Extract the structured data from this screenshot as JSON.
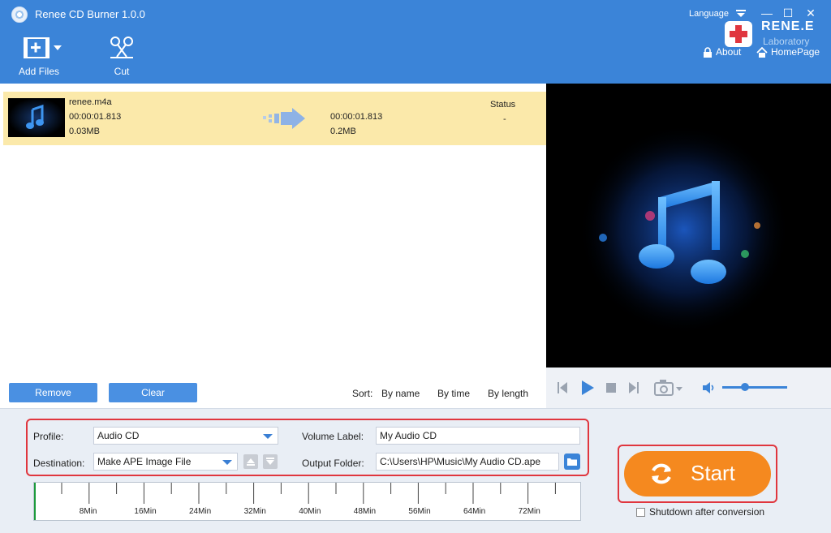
{
  "app": {
    "title": "Renee CD Burner 1.0.0",
    "language_label": "Language"
  },
  "window": {
    "minimize": "—",
    "maximize": "☐",
    "close": "✕"
  },
  "toolbar": {
    "add_files_label": "Add Files",
    "cut_label": "Cut"
  },
  "brand": {
    "name": "RENE.E",
    "sub": "Laboratory",
    "about_label": "About",
    "homepage_label": "HomePage"
  },
  "file": {
    "name": "renee.m4a",
    "src_duration": "00:00:01.813",
    "src_size": "0.03MB",
    "out_duration": "00:00:01.813",
    "out_size": "0.2MB",
    "status_header": "Status",
    "status_value": "-"
  },
  "list_actions": {
    "remove_label": "Remove",
    "clear_label": "Clear"
  },
  "sort": {
    "label": "Sort:",
    "by_name": "By name",
    "by_time": "By time",
    "by_length": "By length"
  },
  "player": {
    "volume_level": 0.35
  },
  "settings": {
    "profile_label": "Profile:",
    "profile_value": "Audio CD",
    "destination_label": "Destination:",
    "destination_value": "Make APE Image File",
    "volume_label_label": "Volume Label:",
    "volume_label_value": "My Audio CD",
    "output_folder_label": "Output Folder:",
    "output_folder_value": "C:\\Users\\HP\\Music\\My Audio CD.ape"
  },
  "timeline": {
    "ticks": [
      "8Min",
      "16Min",
      "24Min",
      "32Min",
      "40Min",
      "48Min",
      "56Min",
      "64Min",
      "72Min"
    ]
  },
  "start": {
    "label": "Start",
    "shutdown_label": "Shutdown after conversion"
  },
  "colors": {
    "header": "#3b84d8",
    "accent": "#4a90e2",
    "start": "#f5891f",
    "highlight": "#e0363e",
    "selected_row": "#fbe9aa"
  }
}
